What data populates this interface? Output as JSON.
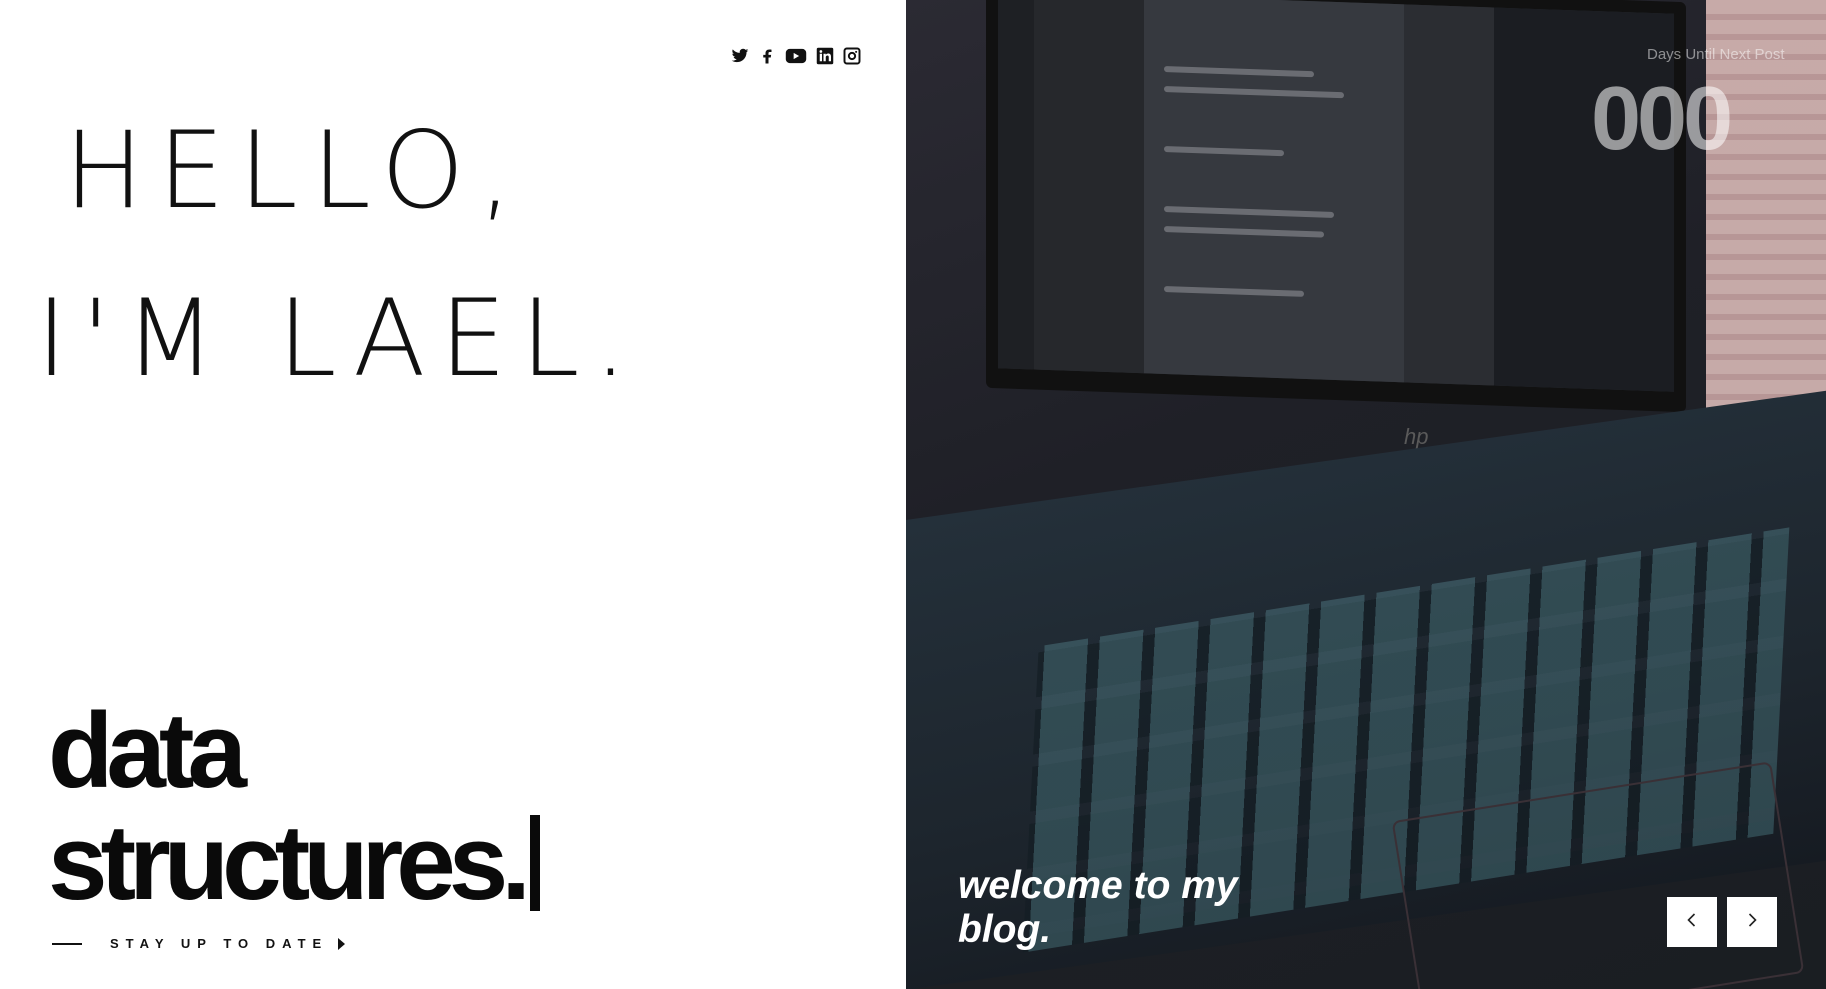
{
  "social": {
    "icons": [
      "twitter-icon",
      "facebook-icon",
      "youtube-icon",
      "linkedin-icon",
      "instagram-icon"
    ]
  },
  "hero": {
    "greeting_line1": "HELLO,",
    "greeting_line2": "I'M LAEL.",
    "headline_line1": "data",
    "headline_line2": "structures."
  },
  "cta": {
    "label": "STAY UP TO DATE"
  },
  "countdown": {
    "label": "Days Until Next Post",
    "value": "000"
  },
  "banner": {
    "welcome_text": "welcome to my blog."
  },
  "carousel": {
    "prev_icon": "chevron-left-icon",
    "next_icon": "chevron-right-icon"
  },
  "colors": {
    "text_dark": "#0a0a0a",
    "background_left": "#ffffff",
    "button_bg": "#ffffff"
  }
}
